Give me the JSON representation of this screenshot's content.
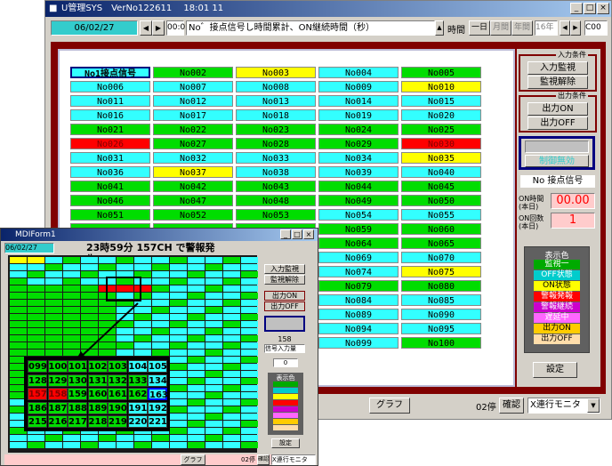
{
  "colors": {
    "green": "#00dd00",
    "cyan": "#33ffff",
    "yellow": "#ffff00",
    "red": "#ff0000",
    "maroon": "#800000",
    "gray": "#d4d0c8"
  },
  "main": {
    "title": "U管理SYS　VerNo122611　 18:01 11",
    "toolbar": {
      "date": "06/02/27",
      "prefix": "00:0",
      "description": "No゛接点信号し時間累計、ON継続時間（秒）",
      "time_label": "時間",
      "day_btn": "一日",
      "month_btn": "月間",
      "year_btn": "年間",
      "count_field": "16年",
      "right_label": "C00"
    },
    "cells": [
      {
        "label": "No1接点信号",
        "color": "cyan"
      },
      {
        "label": "No002",
        "color": "green"
      },
      {
        "label": "No003",
        "color": "yellow"
      },
      {
        "label": "No004",
        "color": "cyan"
      },
      {
        "label": "No005",
        "color": "green"
      },
      {
        "label": "No006",
        "color": "cyan"
      },
      {
        "label": "No007",
        "color": "cyan"
      },
      {
        "label": "No008",
        "color": "cyan"
      },
      {
        "label": "No009",
        "color": "cyan"
      },
      {
        "label": "No010",
        "color": "yellow"
      },
      {
        "label": "No011",
        "color": "cyan"
      },
      {
        "label": "No012",
        "color": "cyan"
      },
      {
        "label": "No013",
        "color": "cyan"
      },
      {
        "label": "No014",
        "color": "cyan"
      },
      {
        "label": "No015",
        "color": "cyan"
      },
      {
        "label": "No016",
        "color": "cyan"
      },
      {
        "label": "No017",
        "color": "cyan"
      },
      {
        "label": "No018",
        "color": "cyan"
      },
      {
        "label": "No019",
        "color": "cyan"
      },
      {
        "label": "No020",
        "color": "cyan"
      },
      {
        "label": "No021",
        "color": "green"
      },
      {
        "label": "No022",
        "color": "green"
      },
      {
        "label": "No023",
        "color": "green"
      },
      {
        "label": "No024",
        "color": "green"
      },
      {
        "label": "No025",
        "color": "green"
      },
      {
        "label": "No026",
        "color": "red"
      },
      {
        "label": "No027",
        "color": "green"
      },
      {
        "label": "No028",
        "color": "green"
      },
      {
        "label": "No029",
        "color": "green"
      },
      {
        "label": "No030",
        "color": "red"
      },
      {
        "label": "No031",
        "color": "cyan"
      },
      {
        "label": "No032",
        "color": "cyan"
      },
      {
        "label": "No033",
        "color": "cyan"
      },
      {
        "label": "No034",
        "color": "cyan"
      },
      {
        "label": "No035",
        "color": "yellow"
      },
      {
        "label": "No036",
        "color": "cyan"
      },
      {
        "label": "No037",
        "color": "yellow"
      },
      {
        "label": "No038",
        "color": "cyan"
      },
      {
        "label": "No039",
        "color": "cyan"
      },
      {
        "label": "No040",
        "color": "cyan"
      },
      {
        "label": "No041",
        "color": "green"
      },
      {
        "label": "No042",
        "color": "green"
      },
      {
        "label": "No043",
        "color": "green"
      },
      {
        "label": "No044",
        "color": "green"
      },
      {
        "label": "No045",
        "color": "green"
      },
      {
        "label": "No046",
        "color": "green"
      },
      {
        "label": "No047",
        "color": "green"
      },
      {
        "label": "No048",
        "color": "green"
      },
      {
        "label": "No049",
        "color": "green"
      },
      {
        "label": "No050",
        "color": "green"
      },
      {
        "label": "No051",
        "color": "green"
      },
      {
        "label": "No052",
        "color": "green"
      },
      {
        "label": "No053",
        "color": "green"
      },
      {
        "label": "No054",
        "color": "cyan"
      },
      {
        "label": "No055",
        "color": "cyan"
      },
      {
        "label": "",
        "color": "green"
      },
      {
        "label": "",
        "color": "green"
      },
      {
        "label": "",
        "color": "green"
      },
      {
        "label": "No059",
        "color": "green"
      },
      {
        "label": "No060",
        "color": "green"
      },
      {
        "label": "",
        "color": "green"
      },
      {
        "label": "",
        "color": "green"
      },
      {
        "label": "",
        "color": "green"
      },
      {
        "label": "No064",
        "color": "green"
      },
      {
        "label": "No065",
        "color": "green"
      },
      {
        "label": "",
        "color": "green"
      },
      {
        "label": "",
        "color": "green"
      },
      {
        "label": "",
        "color": "green"
      },
      {
        "label": "No069",
        "color": "cyan"
      },
      {
        "label": "No070",
        "color": "cyan"
      },
      {
        "label": "",
        "color": "green"
      },
      {
        "label": "",
        "color": "green"
      },
      {
        "label": "",
        "color": "green"
      },
      {
        "label": "No074",
        "color": "cyan"
      },
      {
        "label": "No075",
        "color": "yellow"
      },
      {
        "label": "",
        "color": "green"
      },
      {
        "label": "",
        "color": "green"
      },
      {
        "label": "",
        "color": "green"
      },
      {
        "label": "No079",
        "color": "green"
      },
      {
        "label": "No080",
        "color": "green"
      },
      {
        "label": "",
        "color": "green"
      },
      {
        "label": "",
        "color": "green"
      },
      {
        "label": "",
        "color": "green"
      },
      {
        "label": "No084",
        "color": "cyan"
      },
      {
        "label": "No085",
        "color": "cyan"
      },
      {
        "label": "",
        "color": "green"
      },
      {
        "label": "",
        "color": "green"
      },
      {
        "label": "",
        "color": "green"
      },
      {
        "label": "No089",
        "color": "cyan"
      },
      {
        "label": "No090",
        "color": "cyan"
      },
      {
        "label": "",
        "color": "green"
      },
      {
        "label": "",
        "color": "green"
      },
      {
        "label": "",
        "color": "green"
      },
      {
        "label": "No094",
        "color": "cyan"
      },
      {
        "label": "No095",
        "color": "cyan"
      },
      {
        "label": "",
        "color": "green"
      },
      {
        "label": "",
        "color": "green"
      },
      {
        "label": "",
        "color": "green"
      },
      {
        "label": "No099",
        "color": "cyan"
      },
      {
        "label": "No100",
        "color": "green"
      }
    ],
    "right": {
      "input_group": "入力条件",
      "input_monitor": "入力監視",
      "monitor_release": "監視解除",
      "output_group": "出力条件",
      "output_on": "出力ON",
      "output_off": "出力OFF",
      "control_btn": "制御無効",
      "signal_name": "No 接点信号",
      "on_time_label": "ON時間(本日)",
      "on_time_value": "00.00",
      "on_count_label": "ON回数(本日)",
      "on_count_value": "1",
      "legend_title": "表示色",
      "legend": [
        {
          "label": "監視一",
          "color": "#00aa00"
        },
        {
          "label": "OFF状態",
          "color": "#00cccc"
        },
        {
          "label": "ON状態",
          "color": "#ffff00"
        },
        {
          "label": "警報発報",
          "color": "#ff0000"
        },
        {
          "label": "警報継続",
          "color": "#cc00cc"
        },
        {
          "label": "遅延中",
          "color": "#ff66ff"
        },
        {
          "label": "出力ON",
          "color": "#ffcc00"
        },
        {
          "label": "出力OFF",
          "color": "#ffddaa"
        }
      ],
      "settings_btn": "設定"
    },
    "bottom": {
      "graph_btn": "グラフ",
      "stop_label": "02停",
      "stop_btn": "確認",
      "mode_select": "X連行モニタ"
    }
  },
  "small": {
    "title": "MDIForm1",
    "date": "06/02/27",
    "banner": "23時59分 157CH で警報発生",
    "zoom_rows": [
      [
        {
          "v": "099",
          "c": "green"
        },
        {
          "v": "100",
          "c": "green"
        },
        {
          "v": "101",
          "c": "green"
        },
        {
          "v": "102",
          "c": "green"
        },
        {
          "v": "103",
          "c": "green"
        },
        {
          "v": "104",
          "c": "cyan"
        },
        {
          "v": "105",
          "c": "cyan"
        }
      ],
      [
        {
          "v": "128",
          "c": "green"
        },
        {
          "v": "129",
          "c": "green"
        },
        {
          "v": "130",
          "c": "green"
        },
        {
          "v": "131",
          "c": "green"
        },
        {
          "v": "132",
          "c": "green"
        },
        {
          "v": "133",
          "c": "green"
        },
        {
          "v": "134",
          "c": "cyan"
        }
      ],
      [
        {
          "v": "157",
          "c": "red"
        },
        {
          "v": "158",
          "c": "red"
        },
        {
          "v": "159",
          "c": "green"
        },
        {
          "v": "160",
          "c": "green"
        },
        {
          "v": "161",
          "c": "green"
        },
        {
          "v": "162",
          "c": "green"
        },
        {
          "v": "163",
          "c": "cyan"
        }
      ],
      [
        {
          "v": "186",
          "c": "green"
        },
        {
          "v": "187",
          "c": "green"
        },
        {
          "v": "188",
          "c": "green"
        },
        {
          "v": "189",
          "c": "green"
        },
        {
          "v": "190",
          "c": "green"
        },
        {
          "v": "191",
          "c": "cyan"
        },
        {
          "v": "192",
          "c": "cyan"
        }
      ],
      [
        {
          "v": "215",
          "c": "green"
        },
        {
          "v": "216",
          "c": "green"
        },
        {
          "v": "217",
          "c": "green"
        },
        {
          "v": "218",
          "c": "green"
        },
        {
          "v": "219",
          "c": "green"
        },
        {
          "v": "220",
          "c": "cyan"
        },
        {
          "v": "221",
          "c": "cyan"
        }
      ]
    ],
    "right": {
      "input_monitor": "入力監視",
      "monitor_release": "監視解除",
      "output_on": "出力ON",
      "output_off": "出力OFF",
      "count": "158",
      "signal_select": "信号入力量",
      "on_count": "0",
      "legend_title": "表示色",
      "settings_btn": "設定"
    },
    "bottom": {
      "graph_btn": "グラフ",
      "stop_label": "02停",
      "confirm": "確認",
      "mode": "X連行モニタ"
    }
  }
}
